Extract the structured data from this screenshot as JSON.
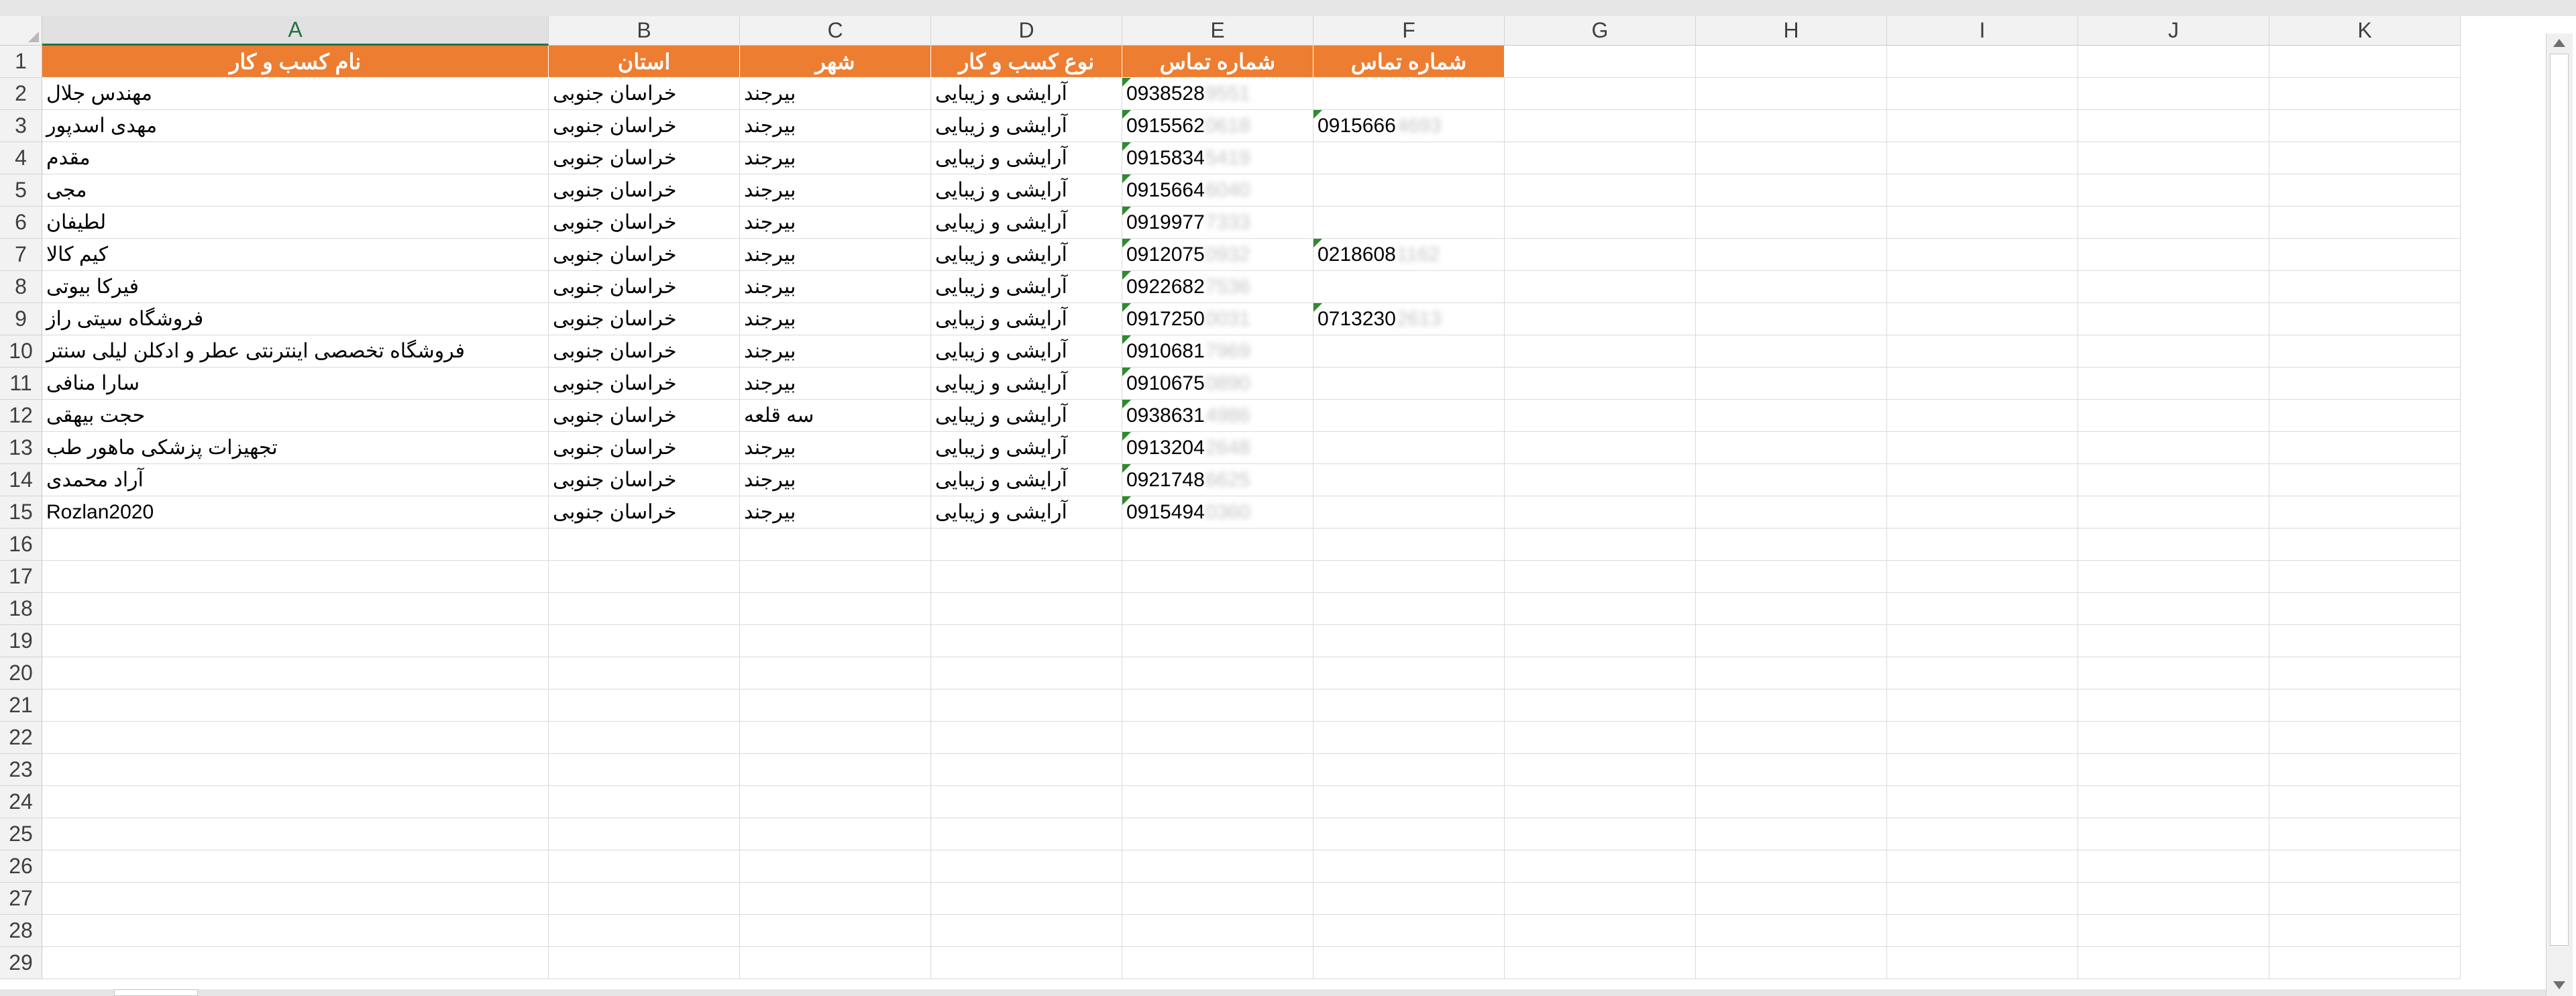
{
  "columns": [
    "A",
    "B",
    "C",
    "D",
    "E",
    "F",
    "G",
    "H",
    "I",
    "J",
    "K"
  ],
  "selected_column": "A",
  "rows": [
    1,
    2,
    3,
    4,
    5,
    6,
    7,
    8,
    9,
    10,
    11,
    12,
    13,
    14,
    15,
    16,
    17,
    18,
    19,
    20,
    21,
    22,
    23,
    24,
    25,
    26,
    27,
    28,
    29
  ],
  "headers": {
    "A": "نام کسب و کار",
    "B": "استان",
    "C": "شهر",
    "D": "نوع کسب و کار",
    "E": "شماره تماس",
    "F": "شماره تماس"
  },
  "header_color": "#ed7d31",
  "data": [
    {
      "A": "مهندس جلال",
      "B": "خراسان جنوبی",
      "C": "بیرجند",
      "D": "آرایشی و زیبایی",
      "E": "0938528",
      "E_hidden": "9551",
      "F": "",
      "F_hidden": ""
    },
    {
      "A": "مهدی اسدپور",
      "B": "خراسان جنوبی",
      "C": "بیرجند",
      "D": "آرایشی و زیبایی",
      "E": "0915562",
      "E_hidden": "0618",
      "F": "0915666",
      "F_hidden": "4693"
    },
    {
      "A": "مقدم",
      "B": "خراسان جنوبی",
      "C": "بیرجند",
      "D": "آرایشی و زیبایی",
      "E": "0915834",
      "E_hidden": "5419",
      "F": "",
      "F_hidden": ""
    },
    {
      "A": "مجی",
      "B": "خراسان جنوبی",
      "C": "بیرجند",
      "D": "آرایشی و زیبایی",
      "E": "0915664",
      "E_hidden": "6040",
      "F": "",
      "F_hidden": ""
    },
    {
      "A": "لطیفان",
      "B": "خراسان جنوبی",
      "C": "بیرجند",
      "D": "آرایشی و زیبایی",
      "E": "0919977",
      "E_hidden": "7333",
      "F": "",
      "F_hidden": ""
    },
    {
      "A": "کیم کالا",
      "B": "خراسان جنوبی",
      "C": "بیرجند",
      "D": "آرایشی و زیبایی",
      "E": "0912075",
      "E_hidden": "0932",
      "F": "0218608",
      "F_hidden": "1162"
    },
    {
      "A": "فیرکا بیوتی",
      "B": "خراسان جنوبی",
      "C": "بیرجند",
      "D": "آرایشی و زیبایی",
      "E": "0922682",
      "E_hidden": "7536",
      "F": "",
      "F_hidden": ""
    },
    {
      "A": "فروشگاه سیتی راز",
      "B": "خراسان جنوبی",
      "C": "بیرجند",
      "D": "آرایشی و زیبایی",
      "E": "0917250",
      "E_hidden": "0031",
      "F": "0713230",
      "F_hidden": "2613"
    },
    {
      "A": "فروشگاه تخصصی اینترنتی عطر و ادکلن لیلی سنتر",
      "B": "خراسان جنوبی",
      "C": "بیرجند",
      "D": "آرایشی و زیبایی",
      "E": "0910681",
      "E_hidden": "7969",
      "F": "",
      "F_hidden": ""
    },
    {
      "A": "سارا منافی",
      "B": "خراسان جنوبی",
      "C": "بیرجند",
      "D": "آرایشی و زیبایی",
      "E": "0910675",
      "E_hidden": "0890",
      "F": "",
      "F_hidden": ""
    },
    {
      "A": "حجت بیهقی",
      "B": "خراسان جنوبی",
      "C": "سه قلعه",
      "D": "آرایشی و زیبایی",
      "E": "0938631",
      "E_hidden": "4986",
      "F": "",
      "F_hidden": ""
    },
    {
      "A": "تجهیزات پزشکی ماهور طب",
      "B": "خراسان جنوبی",
      "C": "بیرجند",
      "D": "آرایشی و زیبایی",
      "E": "0913204",
      "E_hidden": "2648",
      "F": "",
      "F_hidden": ""
    },
    {
      "A": "آراد محمدی",
      "B": "خراسان جنوبی",
      "C": "بیرجند",
      "D": "آرایشی و زیبایی",
      "E": "0921748",
      "E_hidden": "6625",
      "F": "",
      "F_hidden": ""
    },
    {
      "A": "Rozlan2020",
      "B": "خراسان جنوبی",
      "C": "بیرجند",
      "D": "آرایشی و زیبایی",
      "E": "0915494",
      "E_hidden": "0360",
      "F": "",
      "F_hidden": ""
    }
  ]
}
